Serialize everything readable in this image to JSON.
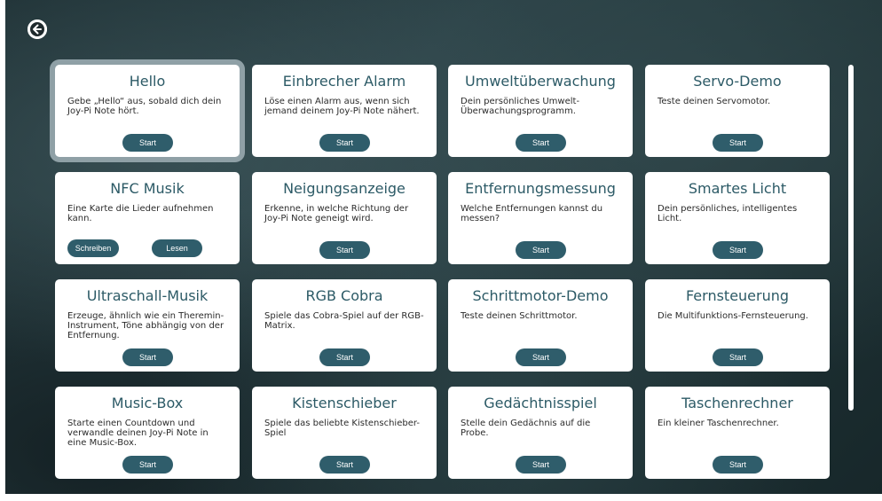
{
  "colors": {
    "accent": "#2f5d6b",
    "title": "#2c5a66",
    "card_bg": "#ffffff",
    "selected_outline": "#8fa0a6"
  },
  "back_button": {
    "icon": "arrow-left-circle-icon"
  },
  "cards": [
    {
      "title": "Hello",
      "description": "Gebe „Hello“ aus, sobald dich dein Joy-Pi Note hört.",
      "buttons": [
        "Start"
      ],
      "selected": true
    },
    {
      "title": "Einbrecher Alarm",
      "description": "Löse einen Alarm aus, wenn sich jemand deinem Joy-Pi Note nähert.",
      "buttons": [
        "Start"
      ]
    },
    {
      "title": "Umweltüberwachung",
      "description": "Dein persönliches Umwelt-Überwachungsprogramm.",
      "buttons": [
        "Start"
      ]
    },
    {
      "title": "Servo-Demo",
      "description": "Teste deinen Servomotor.",
      "buttons": [
        "Start"
      ]
    },
    {
      "title": "NFC Musik",
      "description": "Eine Karte die Lieder aufnehmen kann.",
      "buttons": [
        "Schreiben",
        "Lesen"
      ]
    },
    {
      "title": "Neigungsanzeige",
      "description": "Erkenne, in welche Richtung der Joy-Pi Note geneigt wird.",
      "buttons": [
        "Start"
      ]
    },
    {
      "title": "Entfernungsmessung",
      "description": "Welche Entfernungen kannst du messen?",
      "buttons": [
        "Start"
      ]
    },
    {
      "title": "Smartes Licht",
      "description": "Dein persönliches, intelligentes Licht.",
      "buttons": [
        "Start"
      ]
    },
    {
      "title": "Ultraschall-Musik",
      "description": "Erzeuge, ähnlich wie ein Theremin-Instrument, Töne abhängig von der Entfernung.",
      "buttons": [
        "Start"
      ]
    },
    {
      "title": "RGB Cobra",
      "description": "Spiele das Cobra-Spiel auf der RGB-Matrix.",
      "buttons": [
        "Start"
      ]
    },
    {
      "title": "Schrittmotor-Demo",
      "description": "Teste deinen Schrittmotor.",
      "buttons": [
        "Start"
      ]
    },
    {
      "title": "Fernsteuerung",
      "description": "Die Multifunktions-Fernsteuerung.",
      "buttons": [
        "Start"
      ]
    },
    {
      "title": "Music-Box",
      "description": "Starte einen Countdown und verwandle deinen Joy-Pi Note in eine Music-Box.",
      "buttons": [
        "Start"
      ]
    },
    {
      "title": "Kistenschieber",
      "description": "Spiele das beliebte Kistenschieber-Spiel",
      "buttons": [
        "Start"
      ]
    },
    {
      "title": "Gedächtnisspiel",
      "description": "Stelle dein Gedächnis auf die Probe.",
      "buttons": [
        "Start"
      ]
    },
    {
      "title": "Taschenrechner",
      "description": "Ein kleiner Taschenrechner.",
      "buttons": [
        "Start"
      ]
    }
  ]
}
